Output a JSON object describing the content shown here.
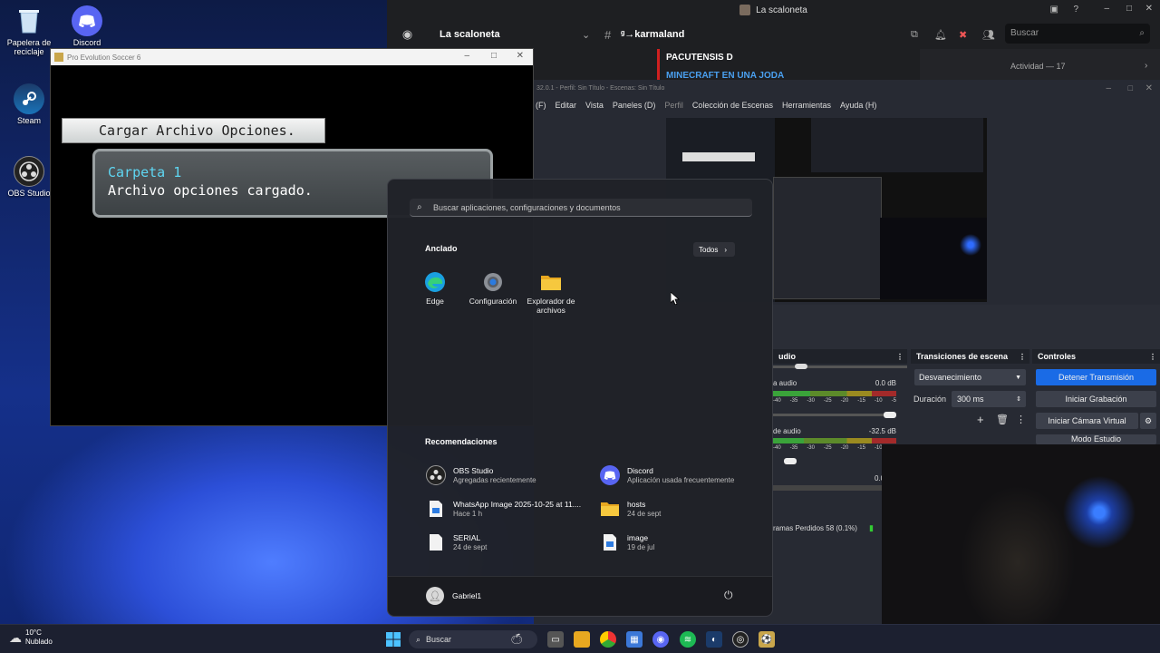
{
  "desktop": {
    "icons": [
      {
        "label": "Papelera de reciclaje"
      },
      {
        "label": "Discord"
      },
      {
        "label": "Steam"
      },
      {
        "label": "OBS Studio"
      }
    ]
  },
  "pes": {
    "window_title": "Pro Evolution Soccer 6",
    "header": "Cargar Archivo Opciones.",
    "slot": "Carpeta 1",
    "message": "Archivo opciones cargado."
  },
  "discord": {
    "window_title": "La scaloneta",
    "server_name": "La scaloneta",
    "channel": "ᵍ→karmaland",
    "search_placeholder": "Buscar",
    "msg_author": "PACUTENSIS D",
    "msg_text": "MINECRAFT EN UNA JODA",
    "activity": "Actividad — 17"
  },
  "obs": {
    "title": "32.0.1 - Perfil: Sin Título - Escenas: Sin Título",
    "menu": [
      "(F)",
      "Editar",
      "Vista",
      "Paneles (D)",
      "Perfil",
      "Colección de Escenas",
      "Herramientas",
      "Ayuda (H)"
    ],
    "audio_head": "udio",
    "audio1_label": "a audio",
    "audio1_db": "0.0 dB",
    "audio2_label": "de audio",
    "audio2_db": "-32.5 dB",
    "audio3_db": "0.0",
    "meter_ticks": [
      "-40",
      "-35",
      "-30",
      "-25",
      "-20",
      "-15",
      "-10"
    ],
    "meter_end": "-5",
    "transitions_head": "Transiciones de escena",
    "transition_value": "Desvanecimiento",
    "duration_label": "Duración",
    "duration_value": "300 ms",
    "controls_head": "Controles",
    "btn_stream": "Detener Transmisión",
    "btn_record": "Iniciar Grabación",
    "btn_vcam": "Iniciar Cámara Virtual",
    "btn_studio": "Modo Estudio",
    "status": "ramas Perdidos 58 (0.1%)",
    "accent": "#1a6be6"
  },
  "start_menu": {
    "search_placeholder": "Buscar aplicaciones, configuraciones y documentos",
    "pinned_title": "Anclado",
    "all_button": "Todos",
    "pinned": [
      {
        "label": "Edge"
      },
      {
        "label": "Configuración"
      },
      {
        "label": "Explorador de archivos"
      }
    ],
    "recommended_title": "Recomendaciones",
    "recommended": [
      {
        "title": "OBS Studio",
        "subtitle": "Agregadas recientemente"
      },
      {
        "title": "Discord",
        "subtitle": "Aplicación usada frecuentemente"
      },
      {
        "title": "WhatsApp Image 2025-10-25 at 11....",
        "subtitle": "Hace 1 h"
      },
      {
        "title": "hosts",
        "subtitle": "24 de sept"
      },
      {
        "title": "SERIAL",
        "subtitle": "24 de sept"
      },
      {
        "title": "image",
        "subtitle": "19 de jul"
      }
    ],
    "user": "Gabriel1"
  },
  "taskbar": {
    "weather_temp": "10°C",
    "weather_desc": "Nublado",
    "search_label": "Buscar"
  }
}
